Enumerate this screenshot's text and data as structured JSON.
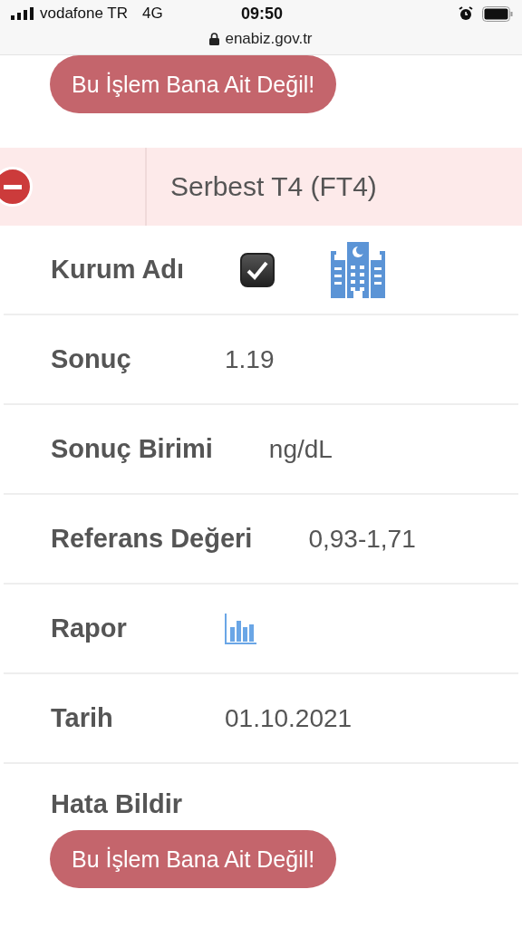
{
  "status_bar": {
    "carrier": "vodafone TR",
    "network": "4G",
    "time": "09:50"
  },
  "address_bar": {
    "url": "enabiz.gov.tr"
  },
  "top_button": "Bu İşlem Bana Ait Değil!",
  "section": {
    "title": "Serbest T4 (FT4)",
    "expanded": true
  },
  "rows": [
    {
      "kind": "checkbox",
      "label": "Kurum Adı",
      "checked": true
    },
    {
      "kind": "text",
      "label": "Sonuç",
      "value": "1.19"
    },
    {
      "kind": "text",
      "label": "Sonuç Birimi",
      "value": "ng/dL"
    },
    {
      "kind": "text",
      "label": "Referans Değeri",
      "value": "0,93-1,71"
    },
    {
      "kind": "report",
      "label": "Rapor"
    },
    {
      "kind": "text",
      "label": "Tarih",
      "value": "01.10.2021"
    }
  ],
  "error_report": {
    "label": "Hata Bildir",
    "button": "Bu İşlem Bana Ait Değil!"
  }
}
